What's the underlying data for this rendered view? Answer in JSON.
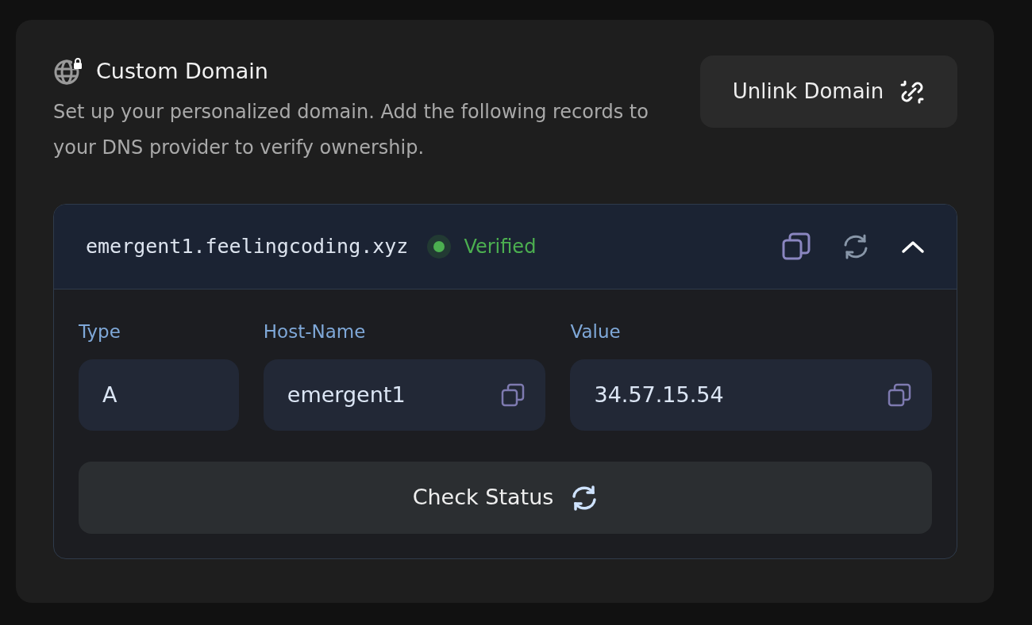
{
  "title": "Custom Domain",
  "description": "Set up your personalized domain. Add the following records to your DNS provider to verify ownership.",
  "unlink_button": "Unlink Domain",
  "domain": {
    "name": "emergent1.feelingcoding.xyz",
    "status": {
      "label": "Verified",
      "color": "#4caf50"
    },
    "expanded": true,
    "fields": [
      {
        "label": "Type",
        "value": "A",
        "copyable": false
      },
      {
        "label": "Host-Name",
        "value": "emergent1",
        "copyable": true
      },
      {
        "label": "Value",
        "value": "34.57.15.54",
        "copyable": true
      }
    ],
    "check_button": "Check Status"
  }
}
